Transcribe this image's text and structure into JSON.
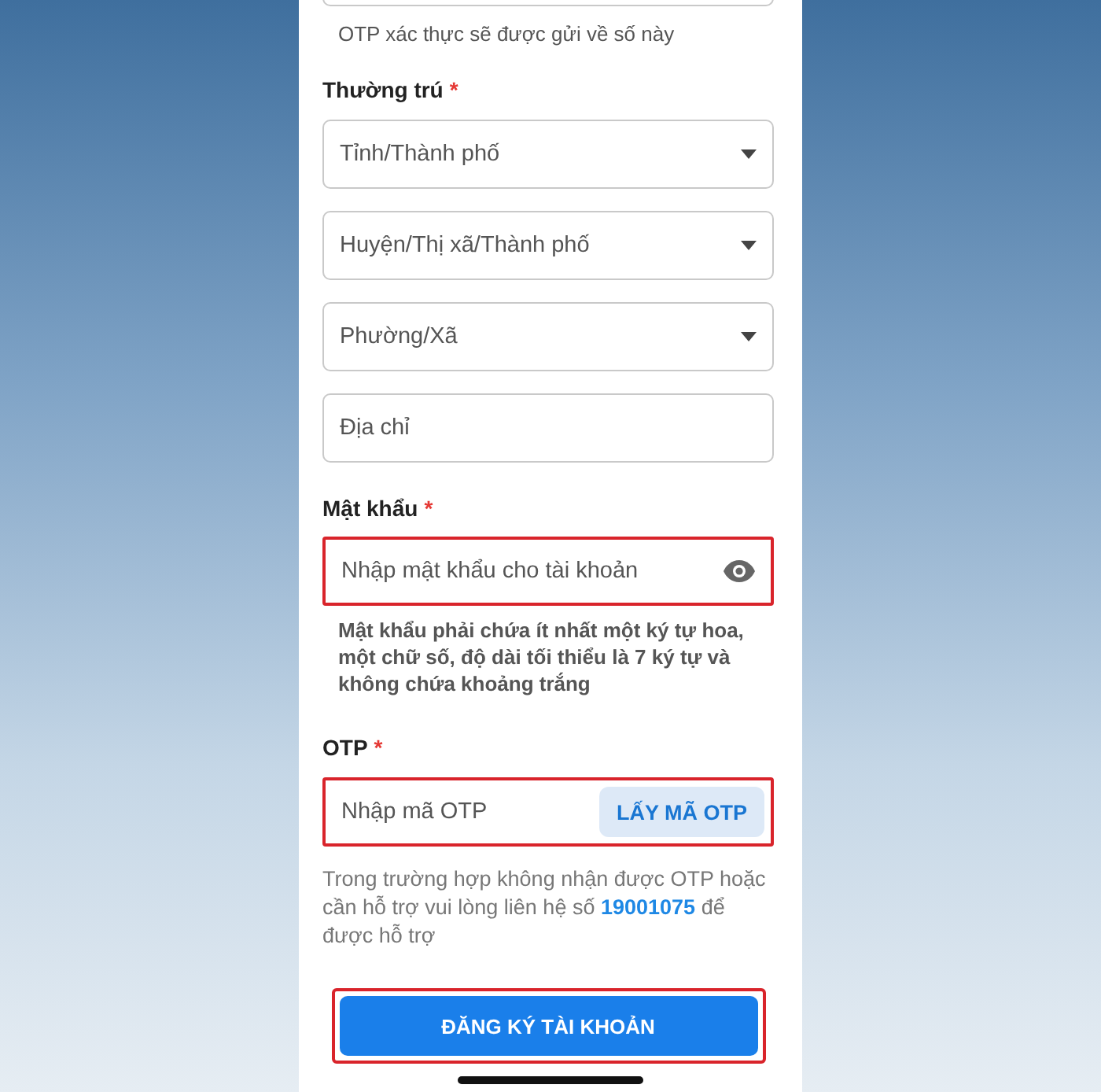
{
  "top_field": {
    "hint": "OTP xác thực sẽ được gửi về số này"
  },
  "address": {
    "label": "Thường trú",
    "required_mark": "*",
    "fields": [
      {
        "kind": "select",
        "placeholder": "Tỉnh/Thành phố"
      },
      {
        "kind": "select",
        "placeholder": "Huyện/Thị xã/Thành phố"
      },
      {
        "kind": "select",
        "placeholder": "Phường/Xã"
      },
      {
        "kind": "text",
        "placeholder": "Địa chỉ"
      }
    ]
  },
  "password": {
    "label": "Mật khẩu",
    "required_mark": "*",
    "placeholder": "Nhập mật khẩu cho tài khoản",
    "highlighted": true,
    "hint": "Mật khẩu phải chứa ít nhất một ký tự hoa, một chữ số, độ dài tối thiểu là 7 ký tự và không chứa khoảng trắng"
  },
  "otp": {
    "label": "OTP",
    "required_mark": "*",
    "placeholder": "Nhập mã OTP",
    "highlighted": true,
    "button": "LẤY MÃ OTP",
    "help_before": "Trong trường hợp không nhận được OTP hoặc cần hỗ trợ vui lòng liên hệ số",
    "help_link": "19001075",
    "help_after": "để được hỗ trợ"
  },
  "submit": {
    "label": "ĐĂNG KÝ TÀI KHOẢN",
    "highlighted": true
  }
}
